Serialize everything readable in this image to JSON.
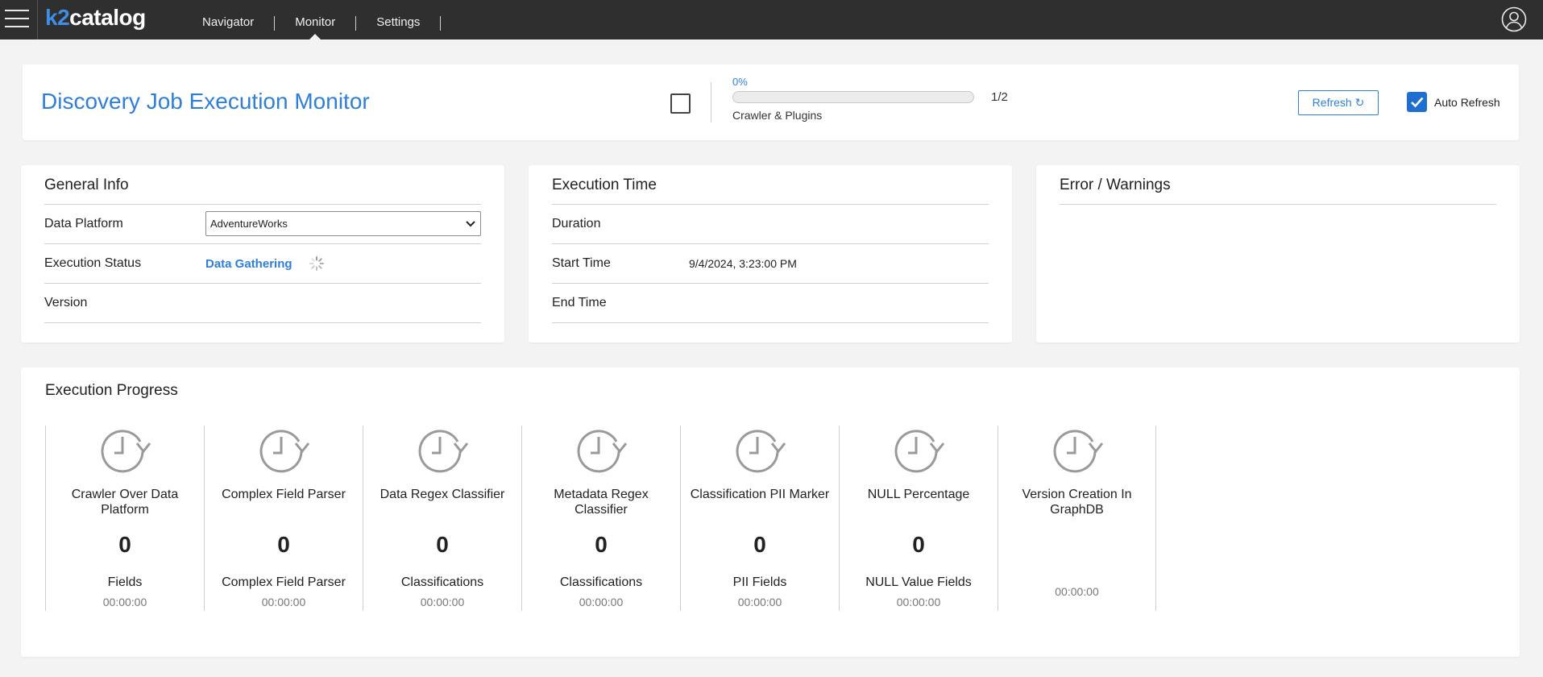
{
  "app": {
    "logo_k2": "k2",
    "logo_catalog": "catalog",
    "nav": [
      {
        "label": "Navigator"
      },
      {
        "label": "Monitor",
        "active": true
      },
      {
        "label": "Settings"
      }
    ],
    "icons": {
      "menu": "hamburger-icon",
      "user": "user-circle-icon"
    }
  },
  "header": {
    "title": "Discovery Job Execution Monitor",
    "progress_percent_label": "0%",
    "progress_fraction": 0,
    "progress_count": "1/2",
    "progress_stage_label": "Crawler & Plugins",
    "refresh_label": "Refresh ↻",
    "auto_refresh_label": "Auto Refresh",
    "auto_refresh_checked": true,
    "select_checked": false
  },
  "general_info": {
    "title": "General Info",
    "data_platform_label": "Data Platform",
    "data_platform_value": "AdventureWorks",
    "execution_status_label": "Execution Status",
    "execution_status_value": "Data Gathering",
    "version_label": "Version",
    "version_value": ""
  },
  "execution_time": {
    "title": "Execution Time",
    "duration_label": "Duration",
    "duration_value": "",
    "start_label": "Start Time",
    "start_value": "9/4/2024, 3:23:00 PM",
    "end_label": "End Time",
    "end_value": ""
  },
  "errors": {
    "title": "Error / Warnings"
  },
  "progress": {
    "title": "Execution Progress",
    "stages": [
      {
        "name": "Crawler Over Data Platform",
        "count": "0",
        "unit": "Fields",
        "time": "00:00:00"
      },
      {
        "name": "Complex Field Parser",
        "count": "0",
        "unit": "Complex Field Parser",
        "time": "00:00:00"
      },
      {
        "name": "Data Regex Classifier",
        "count": "0",
        "unit": "Classifications",
        "time": "00:00:00"
      },
      {
        "name": "Metadata Regex Classifier",
        "count": "0",
        "unit": "Classifications",
        "time": "00:00:00"
      },
      {
        "name": "Classification PII Marker",
        "count": "0",
        "unit": "PII Fields",
        "time": "00:00:00"
      },
      {
        "name": "NULL Percentage",
        "count": "0",
        "unit": "NULL Value Fields",
        "time": "00:00:00"
      },
      {
        "name": "Version Creation In GraphDB",
        "count": "",
        "unit": "",
        "time": "00:00:00"
      }
    ]
  }
}
